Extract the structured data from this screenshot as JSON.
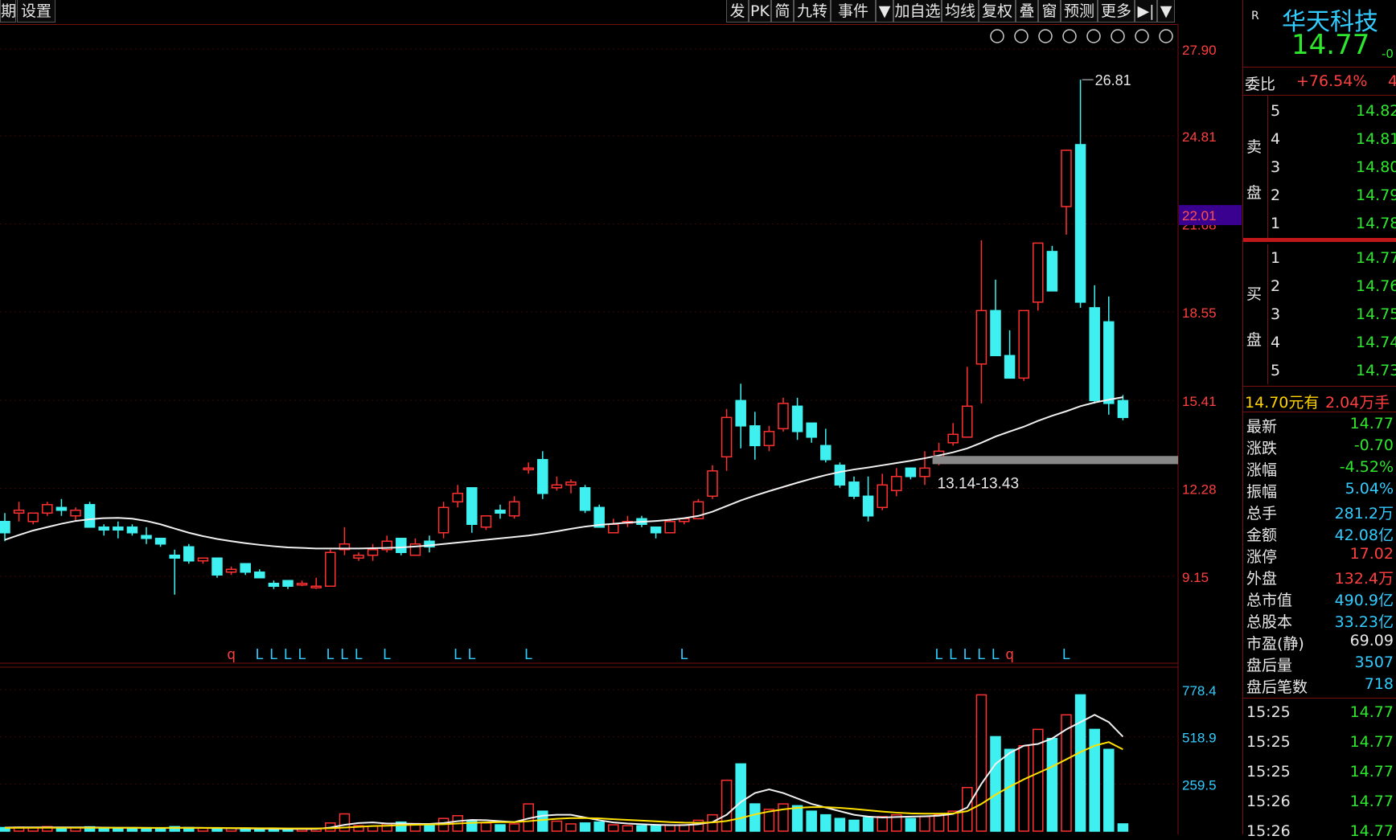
{
  "toolbar": {
    "left": [
      "期",
      "设置"
    ],
    "right": [
      "发",
      "PK",
      "简",
      "九转",
      "事件",
      "▼",
      "加自选",
      "均线",
      "复权",
      "叠",
      "窗",
      "预测",
      "更多",
      "▶|",
      "▼"
    ]
  },
  "stock": {
    "name": "华天科技",
    "price": "14.77",
    "flag": "R",
    "change_short": "-0",
    "weibi_label": "委比",
    "weibi_value": "+76.54%",
    "weibi_extra": "4"
  },
  "sell": {
    "label_a": "卖",
    "label_b": "盘",
    "levels": [
      {
        "n": "5",
        "p": "14.82"
      },
      {
        "n": "4",
        "p": "14.81"
      },
      {
        "n": "3",
        "p": "14.80"
      },
      {
        "n": "2",
        "p": "14.79"
      },
      {
        "n": "1",
        "p": "14.78"
      }
    ]
  },
  "buy": {
    "label_a": "买",
    "label_b": "盘",
    "levels": [
      {
        "n": "1",
        "p": "14.77"
      },
      {
        "n": "2",
        "p": "14.76"
      },
      {
        "n": "3",
        "p": "14.75"
      },
      {
        "n": "4",
        "p": "14.74"
      },
      {
        "n": "5",
        "p": "14.73"
      }
    ]
  },
  "bid_info": {
    "price": "14.70元有",
    "qty": "2.04万手"
  },
  "stats": [
    {
      "k": "最新",
      "v": "14.77",
      "c": "green"
    },
    {
      "k": "涨跌",
      "v": "-0.70",
      "c": "green"
    },
    {
      "k": "涨幅",
      "v": "-4.52%",
      "c": "green"
    },
    {
      "k": "振幅",
      "v": "5.04%",
      "c": "cyan"
    },
    {
      "k": "总手",
      "v": "281.2万",
      "c": "cyan"
    },
    {
      "k": "金额",
      "v": "42.08亿",
      "c": "cyan"
    },
    {
      "k": "涨停",
      "v": "17.02",
      "c": "red"
    },
    {
      "k": "外盘",
      "v": "132.4万",
      "c": "red"
    },
    {
      "k": "总市值",
      "v": "490.9亿",
      "c": "cyan"
    },
    {
      "k": "总股本",
      "v": "33.23亿",
      "c": "cyan"
    },
    {
      "k": "市盈(静)",
      "v": "69.09",
      "c": "white"
    },
    {
      "k": "盘后量",
      "v": "3507",
      "c": "cyan"
    },
    {
      "k": "盘后笔数",
      "v": "718",
      "c": "cyan"
    }
  ],
  "ticks": [
    {
      "t": "15:25",
      "p": "14.77"
    },
    {
      "t": "15:25",
      "p": "14.77"
    },
    {
      "t": "15:25",
      "p": "14.77"
    },
    {
      "t": "15:26",
      "p": "14.77"
    },
    {
      "t": "15:26",
      "p": "14.77"
    }
  ],
  "chart_data": {
    "type": "candlestick",
    "price_axis": {
      "min": 6.02,
      "max": 27.9,
      "ticks": [
        "27.90",
        "24.81",
        "21.68",
        "18.55",
        "15.41",
        "12.28",
        "9.15"
      ]
    },
    "current_marker": "22.01",
    "peak_label": "26.81",
    "zone_label": "13.14-13.43",
    "zone": [
      13.14,
      13.43
    ],
    "volume_axis": {
      "max": 778.4,
      "ticks": [
        "778.4",
        "518.9",
        "259.5"
      ]
    },
    "markers": [
      "q",
      "L",
      "L",
      "L",
      "L",
      "L",
      "L",
      "L",
      "L",
      "L",
      "L",
      "L",
      "L",
      "L",
      "L",
      "L",
      "L",
      "L",
      "q",
      "L"
    ],
    "candles": [
      [
        11.1,
        11.4,
        10.4,
        10.7
      ],
      [
        11.4,
        11.8,
        11.1,
        11.5
      ],
      [
        11.1,
        11.4,
        11.0,
        11.4
      ],
      [
        11.4,
        11.8,
        11.3,
        11.7
      ],
      [
        11.6,
        11.9,
        11.3,
        11.5
      ],
      [
        11.3,
        11.6,
        11.1,
        11.5
      ],
      [
        11.7,
        11.8,
        10.9,
        10.9
      ],
      [
        10.9,
        11.0,
        10.6,
        10.8
      ],
      [
        10.9,
        11.1,
        10.5,
        10.8
      ],
      [
        10.9,
        11.0,
        10.6,
        10.7
      ],
      [
        10.6,
        10.9,
        10.3,
        10.5
      ],
      [
        10.5,
        10.5,
        10.2,
        10.3
      ],
      [
        9.9,
        10.1,
        8.5,
        9.8
      ],
      [
        10.2,
        10.3,
        9.6,
        9.7
      ],
      [
        9.7,
        9.8,
        9.6,
        9.8
      ],
      [
        9.8,
        9.8,
        9.1,
        9.2
      ],
      [
        9.3,
        9.5,
        9.2,
        9.4
      ],
      [
        9.6,
        9.6,
        9.2,
        9.3
      ],
      [
        9.3,
        9.4,
        9.1,
        9.1
      ],
      [
        8.9,
        9.0,
        8.7,
        8.8
      ],
      [
        9.0,
        9.0,
        8.7,
        8.8
      ],
      [
        8.9,
        9.0,
        8.8,
        8.9
      ],
      [
        8.8,
        9.1,
        8.7,
        8.8
      ],
      [
        8.8,
        10.1,
        8.8,
        10.0
      ],
      [
        10.1,
        10.9,
        9.9,
        10.3
      ],
      [
        9.8,
        10.0,
        9.7,
        9.9
      ],
      [
        9.9,
        10.3,
        9.7,
        10.1
      ],
      [
        10.1,
        10.6,
        10.0,
        10.4
      ],
      [
        10.5,
        10.5,
        9.9,
        10.0
      ],
      [
        9.9,
        10.5,
        9.9,
        10.3
      ],
      [
        10.4,
        10.6,
        10.0,
        10.2
      ],
      [
        10.7,
        11.8,
        10.5,
        11.6
      ],
      [
        11.8,
        12.4,
        11.6,
        12.1
      ],
      [
        12.3,
        12.3,
        10.7,
        11.0
      ],
      [
        10.9,
        11.3,
        10.8,
        11.3
      ],
      [
        11.5,
        11.7,
        11.2,
        11.4
      ],
      [
        11.3,
        12.0,
        11.2,
        11.8
      ],
      [
        13.0,
        13.2,
        12.8,
        13.0
      ],
      [
        13.3,
        13.6,
        11.9,
        12.1
      ],
      [
        12.3,
        12.7,
        12.2,
        12.4
      ],
      [
        12.4,
        12.6,
        12.1,
        12.5
      ],
      [
        12.3,
        12.4,
        11.4,
        11.5
      ],
      [
        11.6,
        11.7,
        10.9,
        10.9
      ],
      [
        10.7,
        11.2,
        10.7,
        11.0
      ],
      [
        11.1,
        11.3,
        10.9,
        11.1
      ],
      [
        11.2,
        11.3,
        10.9,
        11.0
      ],
      [
        10.9,
        10.9,
        10.5,
        10.7
      ],
      [
        10.7,
        11.2,
        10.7,
        11.1
      ],
      [
        11.1,
        11.2,
        11.0,
        11.2
      ],
      [
        11.2,
        11.9,
        11.2,
        11.8
      ],
      [
        12.0,
        13.1,
        11.9,
        12.9
      ],
      [
        13.4,
        15.1,
        12.9,
        14.8
      ],
      [
        15.4,
        16.0,
        13.7,
        14.5
      ],
      [
        14.5,
        15.0,
        13.3,
        13.8
      ],
      [
        13.8,
        14.5,
        13.6,
        14.3
      ],
      [
        14.4,
        15.5,
        14.3,
        15.3
      ],
      [
        15.2,
        15.5,
        14.0,
        14.3
      ],
      [
        14.6,
        14.6,
        13.9,
        14.1
      ],
      [
        13.8,
        14.4,
        13.2,
        13.3
      ],
      [
        13.1,
        13.2,
        12.3,
        12.4
      ],
      [
        12.5,
        12.7,
        11.9,
        12.0
      ],
      [
        12.0,
        12.7,
        11.1,
        11.3
      ],
      [
        11.6,
        12.8,
        11.5,
        12.4
      ],
      [
        12.2,
        13.0,
        12.0,
        12.7
      ],
      [
        13.0,
        13.0,
        12.6,
        12.7
      ],
      [
        12.7,
        13.6,
        12.4,
        13.0
      ],
      [
        13.2,
        13.9,
        13.1,
        13.6
      ],
      [
        13.9,
        14.6,
        13.8,
        14.2
      ],
      [
        14.1,
        16.6,
        14.1,
        15.2
      ],
      [
        16.7,
        21.1,
        15.3,
        18.6
      ],
      [
        18.6,
        19.7,
        17.2,
        17.0
      ],
      [
        17.0,
        17.9,
        16.9,
        16.2
      ],
      [
        16.2,
        18.6,
        16.1,
        18.6
      ],
      [
        18.9,
        20.8,
        18.6,
        21.0
      ],
      [
        20.7,
        20.9,
        19.3,
        19.3
      ],
      [
        22.3,
        22.9,
        21.3,
        24.3
      ],
      [
        24.5,
        26.81,
        18.7,
        18.9
      ],
      [
        18.7,
        19.5,
        15.3,
        15.4
      ],
      [
        18.2,
        19.1,
        14.9,
        15.3
      ],
      [
        15.4,
        15.6,
        14.7,
        14.8
      ]
    ],
    "ma": [
      10.45,
      10.62,
      10.78,
      10.9,
      11.02,
      11.12,
      11.18,
      11.22,
      11.23,
      11.2,
      11.12,
      11.0,
      10.85,
      10.7,
      10.58,
      10.48,
      10.4,
      10.33,
      10.27,
      10.22,
      10.18,
      10.16,
      10.14,
      10.14,
      10.14,
      10.14,
      10.15,
      10.16,
      10.18,
      10.21,
      10.25,
      10.3,
      10.35,
      10.4,
      10.45,
      10.5,
      10.55,
      10.6,
      10.67,
      10.75,
      10.84,
      10.92,
      10.98,
      11.02,
      11.06,
      11.09,
      11.12,
      11.16,
      11.22,
      11.3,
      11.45,
      11.65,
      11.85,
      12.02,
      12.18,
      12.33,
      12.48,
      12.62,
      12.75,
      12.86,
      12.95,
      13.02,
      13.1,
      13.18,
      13.26,
      13.35,
      13.45,
      13.56,
      13.7,
      13.9,
      14.12,
      14.3,
      14.47,
      14.68,
      14.86,
      15.02,
      15.2,
      15.33,
      15.43,
      15.52
    ],
    "volume": [
      20,
      22,
      18,
      25,
      21,
      19,
      24,
      17,
      16,
      18,
      15,
      17,
      25,
      20,
      16,
      14,
      15,
      13,
      12,
      11,
      12,
      11,
      13,
      45,
      95,
      30,
      28,
      40,
      50,
      42,
      38,
      70,
      85,
      60,
      45,
      35,
      40,
      150,
      110,
      55,
      40,
      45,
      50,
      35,
      30,
      30,
      28,
      32,
      35,
      60,
      90,
      280,
      370,
      150,
      120,
      150,
      140,
      110,
      90,
      70,
      60,
      75,
      80,
      90,
      70,
      80,
      90,
      110,
      240,
      750,
      520,
      450,
      470,
      560,
      510,
      640,
      750,
      560,
      450,
      40
    ],
    "volume_ma": [
      20,
      21,
      21,
      21,
      21,
      21,
      21,
      20,
      19,
      19,
      18,
      17,
      19,
      19,
      18,
      17,
      16,
      15,
      14,
      13,
      12,
      12,
      12,
      20,
      35,
      45,
      48,
      42,
      42,
      40,
      40,
      45,
      55,
      62,
      60,
      55,
      50,
      70,
      85,
      90,
      90,
      75,
      60,
      48,
      42,
      38,
      35,
      33,
      33,
      38,
      50,
      90,
      160,
      210,
      230,
      210,
      180,
      150,
      130,
      110,
      90,
      80,
      75,
      78,
      80,
      82,
      85,
      95,
      130,
      260,
      370,
      430,
      470,
      480,
      510,
      560,
      600,
      640,
      600,
      520
    ],
    "volume_ma2": [
      18,
      18,
      19,
      19,
      19,
      19,
      19,
      19,
      19,
      19,
      18,
      18,
      18,
      18,
      18,
      18,
      17,
      17,
      16,
      16,
      15,
      15,
      15,
      16,
      20,
      24,
      28,
      30,
      33,
      35,
      37,
      38,
      42,
      46,
      48,
      50,
      50,
      55,
      62,
      68,
      72,
      72,
      70,
      66,
      62,
      58,
      54,
      50,
      47,
      46,
      48,
      56,
      72,
      92,
      108,
      120,
      128,
      132,
      132,
      128,
      122,
      115,
      108,
      102,
      98,
      96,
      96,
      98,
      110,
      150,
      200,
      245,
      285,
      320,
      355,
      395,
      435,
      470,
      490,
      450
    ]
  }
}
